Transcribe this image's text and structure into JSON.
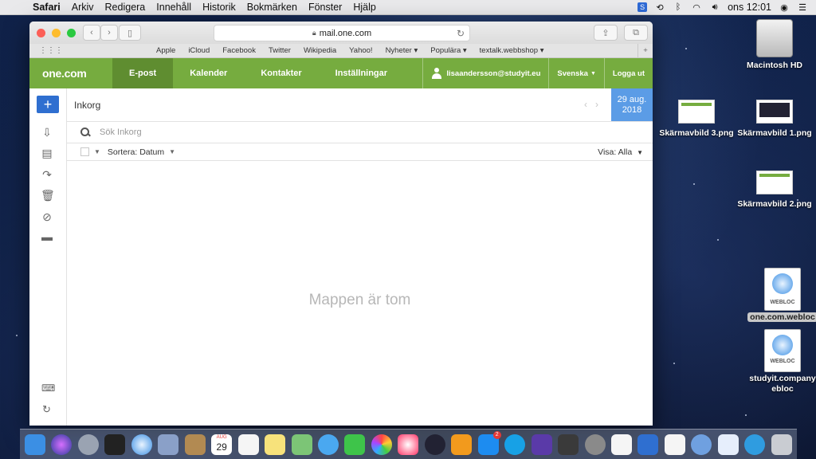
{
  "menubar": {
    "app": "Safari",
    "items": [
      "Arkiv",
      "Redigera",
      "Innehåll",
      "Historik",
      "Bokmärken",
      "Fönster",
      "Hjälp"
    ],
    "clock": "ons 12:01",
    "status_icons": [
      "menu-badge-icon",
      "time-machine-icon",
      "bluetooth-icon",
      "wifi-icon",
      "volume-icon",
      "siri-icon",
      "list-icon"
    ]
  },
  "browser": {
    "url": "mail.one.com",
    "favorites": [
      "Apple",
      "iCloud",
      "Facebook",
      "Twitter",
      "Wikipedia",
      "Yahoo!",
      "Nyheter ▾",
      "Populära ▾",
      "textalk.webbshop ▾"
    ]
  },
  "mail": {
    "logo": "one.com",
    "nav": [
      "E-post",
      "Kalender",
      "Kontakter",
      "Inställningar"
    ],
    "user": "lisaandersson@studyit.eu",
    "language": "Svenska",
    "logout": "Logga ut",
    "folder": "Inkorg",
    "date_line1": "29 aug.",
    "date_line2": "2018",
    "search_placeholder": "Sök Inkorg",
    "sort": "Sortera: Datum",
    "view": "Visa: Alla",
    "empty_message": "Mappen är tom",
    "compose_symbol": "+"
  },
  "desktop": {
    "icons": [
      {
        "label": "Macintosh HD"
      },
      {
        "label": "Skärmavbild 3.png"
      },
      {
        "label": "Skärmavbild 1.png"
      },
      {
        "label": "Skärmavbild 2.png"
      },
      {
        "label": "one.com.webloc"
      },
      {
        "label": "studyit.company.webloc",
        "line1": "studyit.company",
        "line2": "ebloc"
      }
    ],
    "webloc_badge": "WEBLOC"
  },
  "dock": {
    "calendar_month": "AUG",
    "calendar_day": "29",
    "badge": "2"
  }
}
